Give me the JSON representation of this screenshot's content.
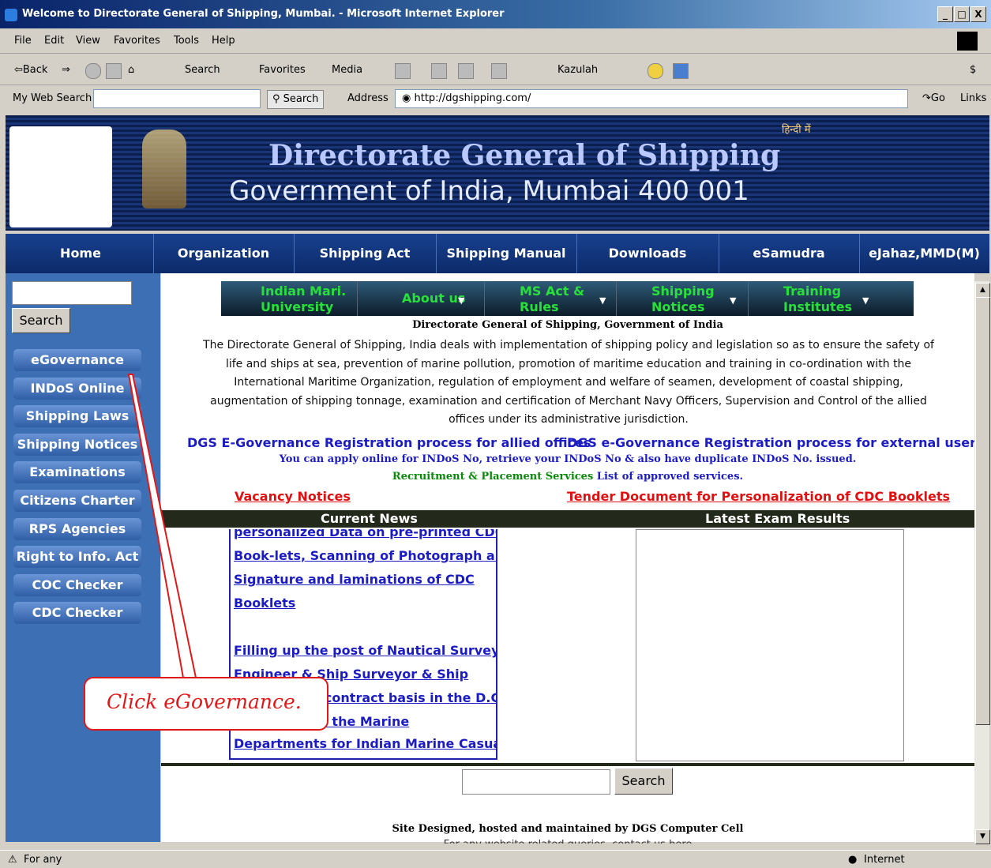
{
  "window": {
    "title": "Welcome to Directorate General of Shipping, Mumbai. - Microsoft Internet Explorer",
    "controls": [
      "_",
      "□",
      "X"
    ]
  },
  "menubar": [
    "File",
    "Edit",
    "View",
    "Favorites",
    "Tools",
    "Help"
  ],
  "toolbar": {
    "back": "⇦Back",
    "search": "Search",
    "favorites": "Favorites",
    "media": "Media",
    "kazulah": "Kazulah"
  },
  "addressbar": {
    "my_web_search": "My Web Search",
    "search_button": "Search",
    "address_label": "Address",
    "url": "http://dgshipping.com/",
    "go": "Go",
    "links": "Links"
  },
  "header": {
    "hindi_link": "हिन्दी में",
    "title": "Directorate General of Shipping",
    "subtitle": "Government of India, Mumbai 400 001"
  },
  "nav": [
    "Home",
    "Organization",
    "Shipping Act",
    "Shipping Manual",
    "Downloads",
    "eSamudra",
    "eJahaz,MMD(M)"
  ],
  "sidebar": {
    "search_button": "Search",
    "items": [
      "eGovernance",
      "INDoS Online",
      "Shipping Laws",
      "Shipping Notices",
      "Examinations",
      "Citizens Charter",
      "RPS Agencies",
      "Right to Info. Act",
      "COC Checker",
      "CDC Checker"
    ]
  },
  "subnav": [
    {
      "line1": "Indian Mari.",
      "line2": "University"
    },
    {
      "line1": "About us",
      "line2": ""
    },
    {
      "line1": "MS Act &",
      "line2": "Rules"
    },
    {
      "line1": "Shipping",
      "line2": "Notices"
    },
    {
      "line1": "Training",
      "line2": "Institutes"
    }
  ],
  "content": {
    "intro_title": "Directorate General of Shipping, Government of India",
    "intro_text": "The Directorate General of Shipping, India deals with implementation of shipping policy and legislation so as to ensure the safety of life and ships at sea, prevention of marine pollution, promotion of maritime education and training in co-ordination with the International Maritime Organization, regulation of employment and welfare of seamen, development of coastal shipping, augmentation of shipping tonnage, examination and certification of Merchant Navy Officers, Supervision and Control of the allied offices under its administrative jurisdiction.",
    "egov_allied": "DGS E-Governance Registration process for allied offices",
    "egov_external": "DGS e-Governance Registration process for external users",
    "indos_line": "You can apply online for INDoS No, retrieve your INDoS No & also have duplicate INDoS No. issued.",
    "recruit_green": "Recruitment & Placement Services",
    "recruit_blue": " List of approved services.",
    "vacancy": "Vacancy Notices",
    "tender": "Tender Document for Personalization of CDC Booklets",
    "current_news": "Current News",
    "latest_results": "Latest Exam Results",
    "news_lines": [
      "personalized Data on pre-printed CDC",
      "Book-lets, Scanning of Photograph and",
      "Signature and laminations of CDC",
      "Booklets",
      "Filling up the post of Nautical Surveyor,",
      "Engineer & Ship Surveyor & Ship",
      "Surveyor on contract basis in the D.G.",
      "Shipping and the Marine",
      "Departments for Indian Marine Casualty"
    ],
    "bottom_search": "Search",
    "footer": "Site Designed, hosted and maintained by DGS Computer Cell",
    "footer2": "For any website related queries, contact us here"
  },
  "status": {
    "left": "For any",
    "zone": "Internet"
  },
  "callout": {
    "text": "Click eGovernance."
  },
  "colors": {
    "nav_bg": "#0c2a69",
    "sidebar_bg": "#3c6fb3",
    "subnav_text": "#27e03a",
    "link_blue": "#1c1cc4",
    "link_red": "#e01010",
    "callout_red": "#e21818"
  }
}
